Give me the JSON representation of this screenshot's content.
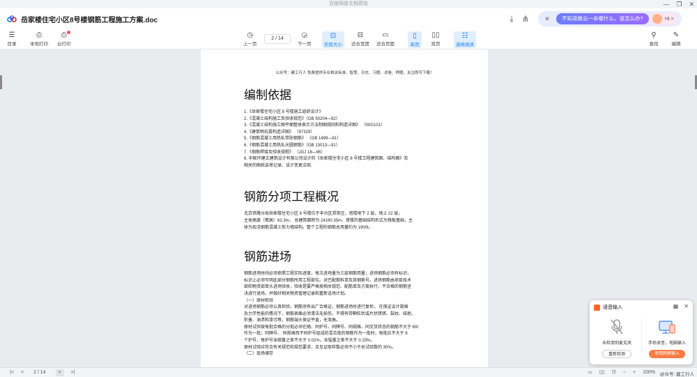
{
  "window": {
    "title": "百度网盘文档预览",
    "controls": [
      "—",
      "❐",
      "✕"
    ]
  },
  "file": {
    "name": "岳家楼住宅小区8号楼钢筋工程施工方案.doc"
  },
  "ai": {
    "prompt": "不知道做云一朵哪什么，该怎么办?",
    "hi": "Hi >"
  },
  "toolbar": {
    "toc": "目录",
    "local_print": "本地打印",
    "cloud_print": "云打印",
    "prev": "上一页",
    "page_indicator": "2 / 14",
    "next": "下一页",
    "actual_size": "实际大小",
    "fit_width": "适合宽度",
    "fit_page": "适合页面",
    "single": "单页",
    "double": "双页",
    "continuous": "连续阅读",
    "find": "查找",
    "edit": "编辑"
  },
  "document": {
    "pubnote": "公众号：建工行人  免费提供专业相关标准、智慧、日志、习题、试卷、押题，关注即可下载！",
    "section1": {
      "title": "编制依据",
      "items": [
        "1.《岳家楼住宅小区 8  号楼施工组织设计》",
        "2.《混凝土结构施工及验收规范》（GB 50204—92）",
        "3.《混凝土结构施工图平面整体表示方法制图规则和构造详图》  （00G101）",
        "4.《建筑物抗震构造详图》  （97329）",
        "5.《钢筋混凝土用热轧带肋钢筋》  （GB 1499—91）",
        "6.《钢筋混凝土用热轧光圆钢筋》（GB 13013—91）",
        "7.《钢筋焊接及验收规程》   （JGJ 18—96）",
        "8. 中联环建文建筑设计有限公司设计的《岳家楼住宅小区 8  号楼工程建筑图、结构图》及",
        "相关的图纸会审记录、设计变更洽商."
      ]
    },
    "section2": {
      "title": "钢筋分项工程概况",
      "lines": [
        "北京铁路分局岳家楼住宅小区 8  号楼位于丰台区郑常庄，塔楼地下 2  层，地上 22  层，",
        "主体高度（檐高）62.3m，   总建筑面积为 24190.35m，塔楼的基础结构形式为筏板基础，主",
        "体为现浇钢筋混凝土剪力墙结构。整个工程的钢筋总用量约为 1900t。"
      ]
    },
    "section3": {
      "title": "钢筋进场",
      "lines": [
        "钢筋进场时间必须依照工程实际进度，每次进场量为三层钢筋用量；进场钢筋必须有标识，",
        "标识上必须写明此部分钢筋所用工程部位。对巴配筋料单及其钢筋号。进场钢筋由项目技术",
        "部和物资部单头进场验收，验收是要严格按相关规范、配筋单及方案执行，不合格的钢筋坚",
        "决进行退场，并做好相关物资管理记录和重新送场计划。",
        "（一）原材检验",
        "对进场钢筋必须认真检验，钢筋须有出厂合格证，钢筋进场时进行复检，  在保证设计规格",
        "及力学性能的情况下，钢筋表面必须清洁无损伤，不得有带颗粒状或片状锈锈、裂纹、结疤、",
        "折叠、油渍和漆污等，钢筋端头保证平直，无弯曲。",
        "原材试验按每批合格的分批必须在随、同炉号、同牌号、同规格、同交货状态的钢筋不大于  60t",
        "作为一批；同牌号、  同规格而不同炉号组成的混合批的钢筋作为一批时，每批应不大于  6",
        "个炉号，每炉号含碳量之差不大于 0.02%，含锰量之差不大于 0.15%。",
        "原材试验应符合有关规范和规范要求，且见证取样数必须不小于总试验数的 30%。",
        "（二）现场储存"
      ]
    }
  },
  "statusbar": {
    "first": "|<",
    "prev": "<",
    "page": "2 / 14",
    "next": ">",
    "last": ">|",
    "zoom": "100%"
  },
  "ime": {
    "title": "语音输入",
    "left_label": "未检测到麦克风",
    "left_button": "重新检测",
    "right_label": "手机收音，电脑输入",
    "right_button": "使用跨屏输入"
  },
  "watermark": "@众号: 建工行人"
}
